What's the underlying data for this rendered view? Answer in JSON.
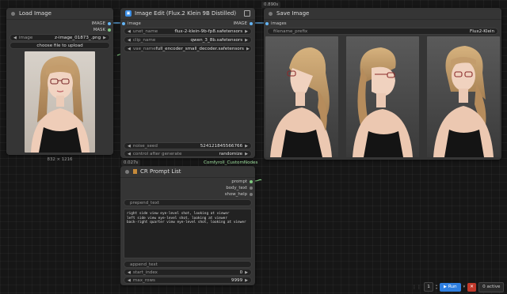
{
  "load_image": {
    "title": "Load Image",
    "outputs": [
      "IMAGE",
      "MASK"
    ],
    "image_label": "image",
    "image_value": "z-image_01873_.png",
    "upload_label": "choose file to upload",
    "dimensions": "832 × 1216"
  },
  "image_edit": {
    "title": "Image Edit (Flux.2 Klein 9B Distilled)",
    "input": "image",
    "output": "IMAGE",
    "widgets": [
      {
        "label": "unet_name",
        "value": "flux-2-klein-9b-fp8.safetensors"
      },
      {
        "label": "clip_name",
        "value": "qwen_3_8b.safetensors"
      },
      {
        "label": "vae_name",
        "value": "full_encoder_small_decoder.safetensors"
      }
    ],
    "noise_seed_label": "noise_seed",
    "noise_seed_value": "524121845566766",
    "control_label": "control after generate",
    "control_value": "randomize",
    "footer": "Comfyroll_CustomNodes"
  },
  "save_image": {
    "title": "Save Image",
    "timer": "0.890s",
    "input": "images",
    "prefix_label": "filename_prefix",
    "prefix_value": "Flux2-Klein"
  },
  "prompt_list": {
    "timer": "0.027s",
    "title": "CR Prompt List",
    "outputs": [
      "prompt",
      "body_text",
      "show_help"
    ],
    "prepend_label": "prepend_text",
    "body_lines": [
      "right side view eye-level shot, looking at viewer",
      "left side view eye-level shot, looking at viewer",
      "back-right quarter view eye-level shot, looking at viewer"
    ],
    "append_label": "append_text",
    "start_index_label": "start_index",
    "start_index_value": "0",
    "max_rows_label": "max_rows",
    "max_rows_value": "9999"
  },
  "toolbar": {
    "batch_count": "1",
    "run_label": "Run",
    "queue_status": "0 active"
  },
  "colors": {
    "image_slot": "#64b5f6",
    "mask_slot": "#81c784",
    "string_slot": "#7fc97f",
    "run_button": "#2f7fe0",
    "cancel_button": "#c0392b"
  }
}
